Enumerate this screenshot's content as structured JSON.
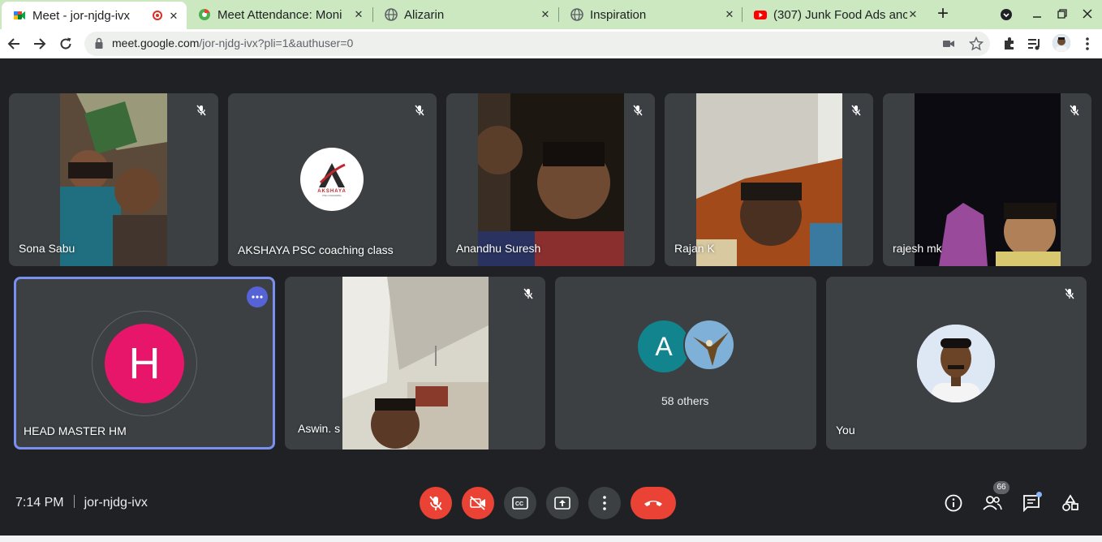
{
  "browser": {
    "tabs": [
      {
        "title": "Meet - jor-njdg-ivx",
        "icon": "meet-icon",
        "active": true
      },
      {
        "title": "Meet Attendance: Moni",
        "icon": "chrome-extension-icon",
        "active": false
      },
      {
        "title": "Alizarin",
        "icon": "globe-icon",
        "active": false
      },
      {
        "title": "Inspiration",
        "icon": "globe-icon",
        "active": false
      },
      {
        "title": "(307) Junk Food Ads anc",
        "icon": "youtube-icon",
        "active": false
      }
    ],
    "url_host": "meet.google.com",
    "url_path": "/jor-njdg-ivx?pli=1&authuser=0"
  },
  "meet": {
    "participants_row1": [
      {
        "name": "Sona Sabu"
      },
      {
        "name": "AKSHAYA PSC coaching class",
        "logo_text": "AKSHAYA",
        "logo_sub": "PSC COACHING"
      },
      {
        "name": "Anandhu Suresh"
      },
      {
        "name": "Rajan K"
      },
      {
        "name": "rajesh mk"
      }
    ],
    "participants_row2": [
      {
        "name": "HEAD MASTER HM",
        "initial": "H"
      },
      {
        "name": "Aswin. s"
      },
      {
        "name": "58 others",
        "initial": "A"
      },
      {
        "name": "You"
      }
    ],
    "colors": {
      "accent_red": "#ea4335",
      "head_master_avatar": "#e8166b",
      "others_avatar": "#12848e",
      "highlight_border": "#7b8ff0"
    },
    "bottom": {
      "time": "7:14 PM",
      "meeting_code": "jor-njdg-ivx",
      "participant_count": "66"
    }
  }
}
